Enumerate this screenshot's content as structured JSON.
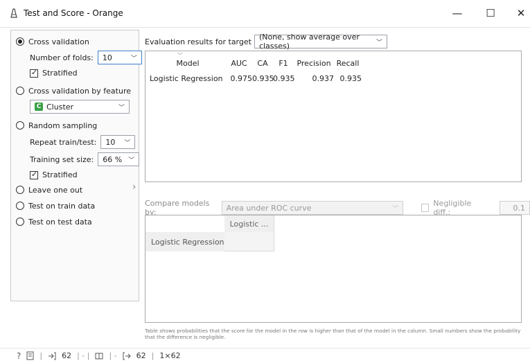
{
  "window": {
    "title": "Test and Score - Orange",
    "min": "—",
    "max": "☐",
    "close": "✕"
  },
  "sampling": {
    "cross_validation": "Cross validation",
    "folds_label": "Number of folds:",
    "folds_value": "10",
    "stratified_1": "Stratified",
    "cv_by_feature": "Cross validation by feature",
    "feature_icon": "C",
    "feature_value": "Cluster",
    "random_sampling": "Random sampling",
    "repeat_label": "Repeat train/test:",
    "repeat_value": "10",
    "train_size_label": "Training set size:",
    "train_size_value": "66 %",
    "stratified_2": "Stratified",
    "leave_one_out": "Leave one out",
    "test_on_train": "Test on train data",
    "test_on_test": "Test on test data"
  },
  "evaluation": {
    "target_label": "Evaluation results for target",
    "target_value": "(None, show average over classes)",
    "columns": [
      "Model",
      "AUC",
      "CA",
      "F1",
      "Precision",
      "Recall"
    ],
    "rows": [
      [
        "Logistic Regression",
        "0.975",
        "0.935",
        "0.935",
        "0.937",
        "0.935"
      ]
    ]
  },
  "compare": {
    "label": "Compare models by:",
    "value": "Area under ROC curve",
    "negligible_label": "Negligible diff.:",
    "negligible_value": "0.1",
    "column_header": "Logistic ...",
    "row_label": "Logistic Regression",
    "note": "Table shows probabilities that the score for the model in the row is higher than that of the model in the column. Small numbers show the probability that the difference is negligible."
  },
  "status": {
    "help": "?",
    "input_count": "62",
    "output_count": "62",
    "output_dims": "1×62"
  }
}
